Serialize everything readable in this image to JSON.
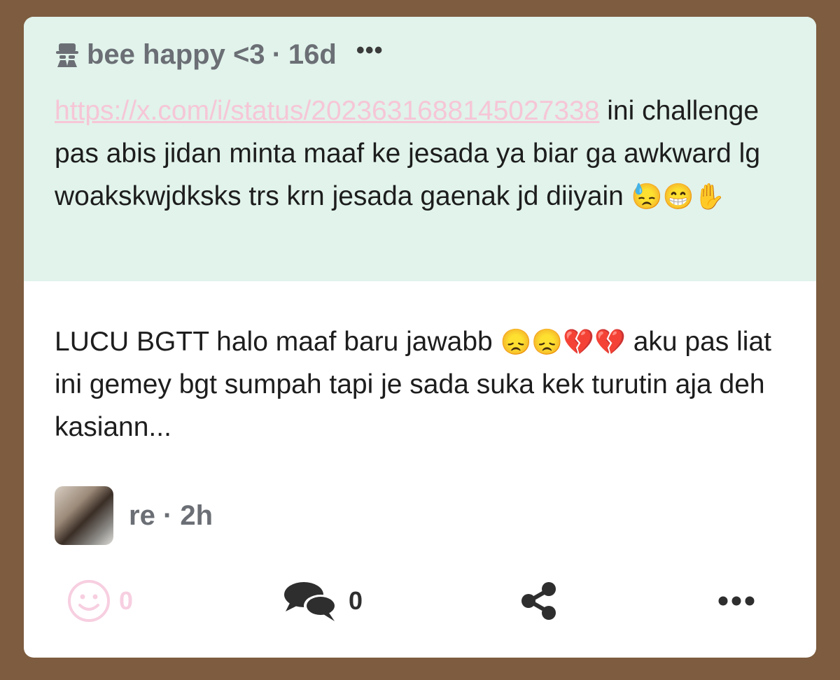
{
  "quoted_post": {
    "author": "bee happy <3",
    "separator": "·",
    "time": "16d",
    "more_label": "•••",
    "link": "https://x.com/i/status/2023631688145027338",
    "text": " ini challenge pas abis jidan minta maaf ke jesada ya biar ga awkward lg woakskwjdksks trs krn jesada gaenak jd diiyain ",
    "emojis": "😓😁✋"
  },
  "reply": {
    "text_part1": "LUCU BGTT halo maaf baru jawabb ",
    "emojis": "😞😞💔💔",
    "text_part2": " aku pas liat ini gemey bgt sumpah tapi je sada suka kek turutin aja deh kasiann...",
    "author": "re",
    "separator": "·",
    "time": "2h"
  },
  "actions": {
    "like_count": "0",
    "comment_count": "0",
    "more_label": "•••"
  },
  "colors": {
    "background": "#7d5c3f",
    "quote_bg": "#e1f3eb",
    "link": "#f6c6d7",
    "muted": "#6b6f75"
  }
}
